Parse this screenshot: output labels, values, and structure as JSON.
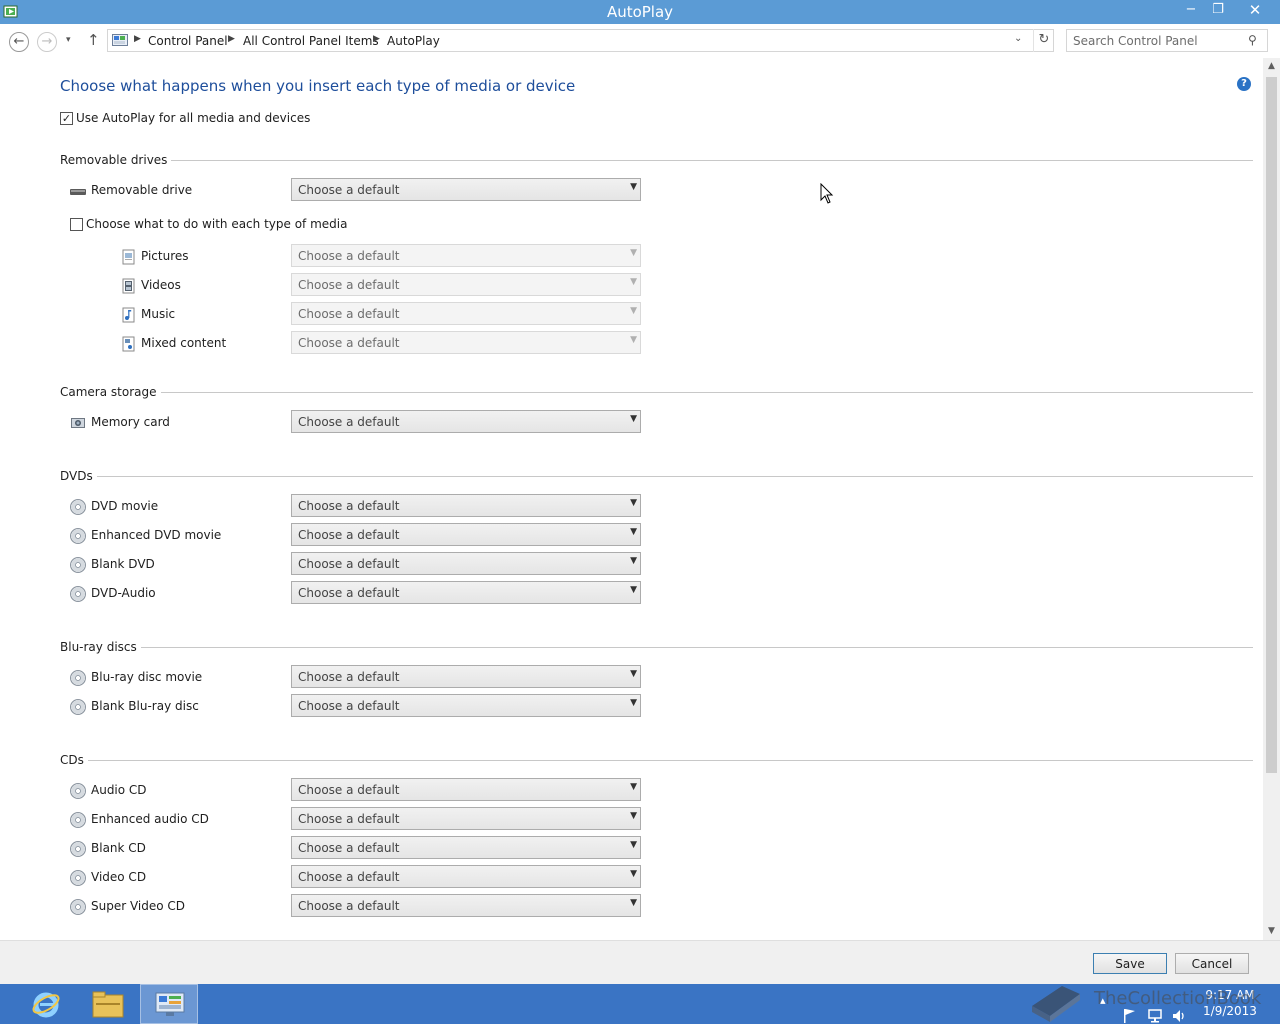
{
  "window": {
    "title": "AutoPlay",
    "minimize_label": "−",
    "maximize_label": "❐",
    "close_label": "✕"
  },
  "address_bar": {
    "back_glyph": "←",
    "forward_glyph": "→",
    "dropdown_glyph": "▾",
    "up_glyph": "↑",
    "breadcrumbs": [
      "Control Panel",
      "All Control Panel Items",
      "AutoPlay"
    ],
    "separator_glyph": "▶",
    "refresh_glyph": "↻",
    "path_dropdown_glyph": "⌄",
    "search_placeholder": "Search Control Panel",
    "search_icon_glyph": "⚲"
  },
  "main": {
    "heading": "Choose what happens when you insert each type of media or device",
    "help_glyph": "?",
    "use_autoplay": {
      "label": "Use AutoPlay for all media and devices",
      "checked": true,
      "check_glyph": "✓"
    },
    "combo_default": "Choose a default",
    "combo_arrow": "▼",
    "removable": {
      "section": "Removable drives",
      "drive_label": "Removable drive",
      "each_type": {
        "label": "Choose what to do with each type of media",
        "checked": false
      },
      "media": [
        "Pictures",
        "Videos",
        "Music",
        "Mixed content"
      ]
    },
    "camera": {
      "section": "Camera storage",
      "items": [
        "Memory card"
      ]
    },
    "dvds": {
      "section": "DVDs",
      "items": [
        "DVD movie",
        "Enhanced DVD movie",
        "Blank DVD",
        "DVD-Audio"
      ]
    },
    "bluray": {
      "section": "Blu-ray discs",
      "items": [
        "Blu-ray disc movie",
        "Blank Blu-ray disc"
      ]
    },
    "cds": {
      "section": "CDs",
      "items": [
        "Audio CD",
        "Enhanced audio CD",
        "Blank CD",
        "Video CD",
        "Super Video CD"
      ]
    }
  },
  "scrollbar": {
    "up_glyph": "▲",
    "down_glyph": "▼"
  },
  "footer": {
    "save_label": "Save",
    "cancel_label": "Cancel"
  },
  "taskbar": {
    "time": "9:17 AM",
    "date": "1/9/2013",
    "tray_up_glyph": "▴",
    "watermark_text": "TheCollectionBook"
  },
  "colors": {
    "title_bar": "#5b9bd5",
    "heading": "#1e4e9b",
    "taskbar": "#3a74c4"
  }
}
